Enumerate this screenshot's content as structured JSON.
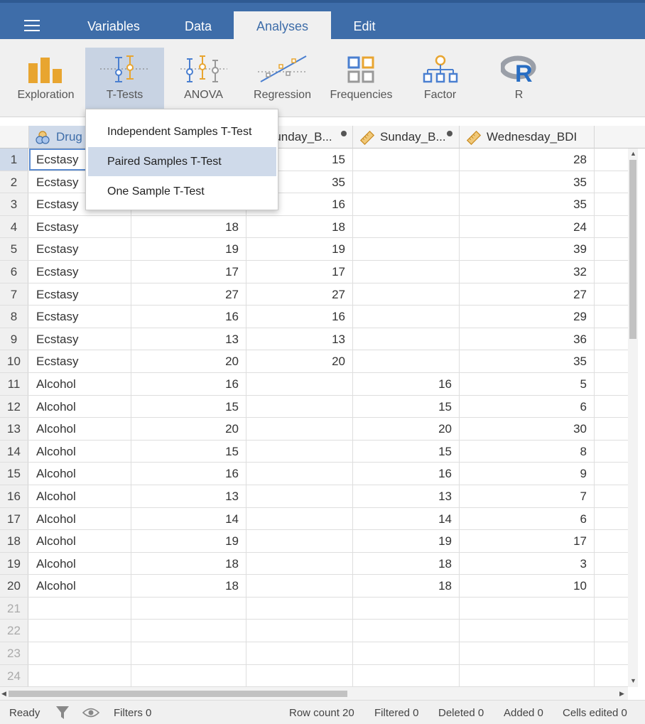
{
  "menu_tabs": [
    "Variables",
    "Data",
    "Analyses",
    "Edit"
  ],
  "active_tab": "Analyses",
  "toolbar": {
    "tools": [
      "Exploration",
      "T-Tests",
      "ANOVA",
      "Regression",
      "Frequencies",
      "Factor",
      "R"
    ],
    "active_tool": "T-Tests"
  },
  "ttest_menu": {
    "items": [
      "Independent Samples T-Test",
      "Paired Samples T-Test",
      "One Sample T-Test"
    ],
    "highlighted": "Paired Samples T-Test"
  },
  "columns": [
    {
      "name": "Drug",
      "type": "nominal"
    },
    {
      "name": "",
      "type": ""
    },
    {
      "name": "Sunday_B...",
      "type": "computed"
    },
    {
      "name": "Sunday_B...",
      "type": "scale-computed"
    },
    {
      "name": "Wednesday_BDI",
      "type": "scale"
    }
  ],
  "rows": [
    [
      "Ecstasy",
      "",
      "15",
      "",
      "28"
    ],
    [
      "Ecstasy",
      "",
      "35",
      "",
      "35"
    ],
    [
      "Ecstasy",
      "",
      "16",
      "",
      "35"
    ],
    [
      "Ecstasy",
      "18",
      "18",
      "",
      "24"
    ],
    [
      "Ecstasy",
      "19",
      "19",
      "",
      "39"
    ],
    [
      "Ecstasy",
      "17",
      "17",
      "",
      "32"
    ],
    [
      "Ecstasy",
      "27",
      "27",
      "",
      "27"
    ],
    [
      "Ecstasy",
      "16",
      "16",
      "",
      "29"
    ],
    [
      "Ecstasy",
      "13",
      "13",
      "",
      "36"
    ],
    [
      "Ecstasy",
      "20",
      "20",
      "",
      "35"
    ],
    [
      "Alcohol",
      "16",
      "",
      "16",
      "5"
    ],
    [
      "Alcohol",
      "15",
      "",
      "15",
      "6"
    ],
    [
      "Alcohol",
      "20",
      "",
      "20",
      "30"
    ],
    [
      "Alcohol",
      "15",
      "",
      "15",
      "8"
    ],
    [
      "Alcohol",
      "16",
      "",
      "16",
      "9"
    ],
    [
      "Alcohol",
      "13",
      "",
      "13",
      "7"
    ],
    [
      "Alcohol",
      "14",
      "",
      "14",
      "6"
    ],
    [
      "Alcohol",
      "19",
      "",
      "19",
      "17"
    ],
    [
      "Alcohol",
      "18",
      "",
      "18",
      "3"
    ],
    [
      "Alcohol",
      "18",
      "",
      "18",
      "10"
    ]
  ],
  "empty_row_numbers": [
    "21",
    "22",
    "23",
    "24"
  ],
  "status": {
    "ready": "Ready",
    "filters": "Filters 0",
    "row_count": "Row count 20",
    "filtered": "Filtered 0",
    "deleted": "Deleted 0",
    "added": "Added 0",
    "cells_edited": "Cells edited 0"
  },
  "colors": {
    "header_blue": "#3e6da9",
    "accent_orange": "#e8a530",
    "accent_blue": "#4a7fd0",
    "selection": "#cfdaea"
  }
}
